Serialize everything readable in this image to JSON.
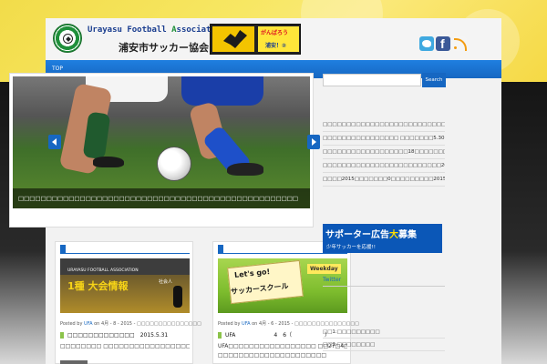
{
  "header": {
    "title_en_a": "Urayasu Football ",
    "title_en_b": "A",
    "title_en_c": "ssociation",
    "title_jp": "浦安市サッカー協会",
    "banner_line1": "がんばろう",
    "banner_line2": "浦安！②"
  },
  "nav": {
    "items": [
      "TOP"
    ]
  },
  "slider": {
    "caption": "□□□□□□□□□□□□□□□□□□□□□□□□□□□□□□□□□□□□□□□□□□□□□□□□□□"
  },
  "search": {
    "button_label": "Search",
    "placeholder": ""
  },
  "sidebar": {
    "recent": [
      "□□□□□□□□□□□□□□□□□□□□□□□□□□2015.5.31□□",
      "□□□□□□□□□□□□□□□□ □□□□□□□5.30□□□",
      "□□□□□□□□□□□□□□□□□□18□□□□□□□□",
      "□□□□□□□□□□□□□□□□□□□□□□□□□2015.5.24□□□",
      "□□□□2015□□□□□□□0□□□□□□□□□2015.5.9□□"
    ],
    "banner_big_a": "サポーター広告",
    "banner_big_b": "大",
    "banner_big_c": "募集",
    "banner_small": "少年サッカーを応援!!",
    "twitter_label": "Twitter",
    "bottom": [
      "□□1:□□□□□□□□□",
      "□□2:□□□□□□□□"
    ]
  },
  "posts": [
    {
      "thumb_en": "URAYASU FOOTBALL ASSOCIATION",
      "thumb_jp": "1種 大会情報",
      "thumb_sub": "社会人",
      "meta_prefix": "Posted by ",
      "author": "UFA",
      "meta_suffix": " on 4月 - 8 - 2015 - □□□□□□□□□□□□□□□",
      "line1": "□□□□□□□□□□□□□　2015.5.31",
      "line2": "□□□□□□□□ □□□□□□□□□□□□□□□□□□□ □□□□□□□□□□□□□"
    },
    {
      "thumb_sign1": "Let's go!",
      "thumb_sign2": "サッカースクール",
      "thumb_week": "Weekday",
      "meta_prefix": "Posted by ",
      "author": "UFA",
      "meta_suffix": " on 4月 - 6 - 2015 - □□□□□□□□□□□□□□□",
      "line1": "UFA　　　　　　　4　6（　　　　　　）",
      "line2": "UFA□□□□□□□□□□□□□□□□□ □□27□4□□5□6□□□□□□□□□□□□□□",
      "line3": "□□□□□□□□□□□□□□□□□□□□□"
    }
  ]
}
